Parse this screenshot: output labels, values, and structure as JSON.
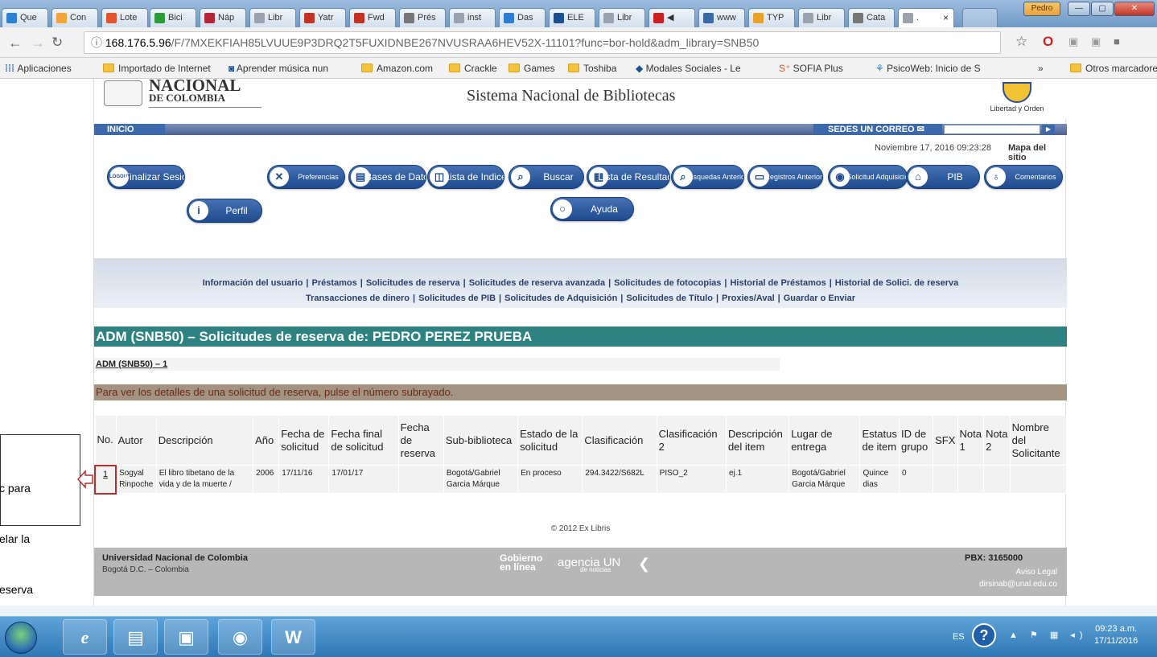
{
  "browser": {
    "tabs": [
      {
        "label": "Que",
        "color": "#2d7fd3"
      },
      {
        "label": "Con",
        "color": "#f2a43a"
      },
      {
        "label": "Lote",
        "color": "#e0552b"
      },
      {
        "label": "Bici",
        "color": "#2c9c3a"
      },
      {
        "label": "Náp",
        "color": "#b3263a"
      },
      {
        "label": "Libr",
        "color": "#9aa3ad"
      },
      {
        "label": "Yatr",
        "color": "#c23321"
      },
      {
        "label": "Fwd",
        "color": "#c23321"
      },
      {
        "label": "Prés",
        "color": "#777777"
      },
      {
        "label": "inst",
        "color": "#9aa3ad"
      },
      {
        "label": "Das",
        "color": "#2d7fd3"
      },
      {
        "label": "ELE",
        "color": "#1c4f8f"
      },
      {
        "label": "Libr",
        "color": "#9aa3ad"
      },
      {
        "label": "◀",
        "color": "#cc1f1f"
      },
      {
        "label": "www",
        "color": "#3a6aa5"
      },
      {
        "label": "TYP",
        "color": "#e8a22a"
      },
      {
        "label": "Libr",
        "color": "#9aa3ad"
      },
      {
        "label": "Cata",
        "color": "#777777"
      },
      {
        "label": ".",
        "color": "#9aa3ad"
      }
    ],
    "user_badge": "Pedro",
    "url_host": "168.176.5.96",
    "url_path": "/F/7MXEKFIAH85LVUUE9P3DRQ2T5FUXIDNBE267NVUSRAA6HEV52X-11101?func=bor-hold&adm_library=SNB50",
    "bookmarks": [
      "Aplicaciones",
      "Importado de Internet",
      "Aprender música nun",
      "Amazon.com",
      "Crackle",
      "Games",
      "Toshiba",
      "Modales Sociales - Le",
      "SOFIA Plus",
      "PsicoWeb: Inicio de S"
    ],
    "bookmarks_more": "»",
    "bookmarks_other": "Otros marcadores"
  },
  "header": {
    "logo_line1": "NACIONAL",
    "logo_line2": "DE COLOMBIA",
    "title": "Sistema Nacional de Bibliotecas",
    "coat_label": "Libertad y Orden",
    "inicio": "INICIO",
    "sedes": "SEDES UN  CORREO ✉",
    "date": "Noviembre 17, 2016 09:23:28",
    "mapa": "Mapa del sitio"
  },
  "nav_buttons": [
    {
      "label": "Finalizar Sesión",
      "icon": "LOGOUT"
    },
    {
      "label": "Perfil",
      "icon": "i"
    },
    {
      "label": "Preferencias",
      "icon": "✕"
    },
    {
      "label": "Bases de Datos",
      "icon": "▤"
    },
    {
      "label": "Lista de Indices",
      "icon": "◫"
    },
    {
      "label": "Buscar",
      "icon": "⌕"
    },
    {
      "label": "Lista de Resultados",
      "icon": "▦"
    },
    {
      "label": "Busquedas Anteriores",
      "icon": "⌕"
    },
    {
      "label": "Registros Anteriores",
      "icon": "▭"
    },
    {
      "label": "Solicitud Adquisición",
      "icon": "◉"
    },
    {
      "label": "PIB",
      "icon": "⌂"
    },
    {
      "label": "Comentarios",
      "icon": "♁"
    },
    {
      "label": "Ayuda",
      "icon": "○"
    }
  ],
  "links_row1": [
    "Información del usuario",
    "Préstamos",
    "Solicitudes de reserva",
    "Solicitudes de reserva avanzada",
    "Solicitudes de fotocopias",
    "Historial de Préstamos",
    "Historial de Solici. de reserva"
  ],
  "links_row2": [
    "Transacciones de dinero",
    "Solicitudes de PIB",
    "Solicitudes de Adquisición",
    "Solicitudes de Título",
    "Proxies/Aval",
    "Guardar o Enviar"
  ],
  "section_title": "ADM (SNB50) – Solicitudes de reserva de: PEDRO PEREZ PRUEBA",
  "adm_link": "ADM (SNB50) – 1",
  "info_text": "Para ver los detalles de una solicitud de reserva, pulse el número subrayado.",
  "table": {
    "headers": [
      "No.",
      "Autor",
      "Descripción",
      "Año",
      "Fecha de solicitud",
      "Fecha final de solicitud",
      "Fecha de reserva",
      "Sub-biblioteca",
      "Estado de la solicitud",
      "Clasificación",
      "Clasificación 2",
      "Descripción del item",
      "Lugar de entrega",
      "Estatus de item",
      "ID de grupo",
      "SFX",
      "Nota 1",
      "Nota 2",
      "Nombre del Solicitante"
    ],
    "rows": [
      [
        "1",
        "Sogyal Rinpoche",
        "El libro tibetano de la vida y de la muerte /",
        "2006",
        "17/11/16",
        "17/01/17",
        "",
        "Bogotá/Gabriel Garcia Márque",
        "En proceso",
        "294.3422/S682L",
        "PISO_2",
        "ej.1",
        "Bogotá/Gabriel Garcia Márque",
        "Quince dias",
        "0",
        "",
        "",
        "",
        ""
      ]
    ]
  },
  "copyright": "© 2012 Ex Libris",
  "footer": {
    "university": "Universidad Nacional de Colombia",
    "city": "Bogotá D.C. – Colombia",
    "gobierno": "Gobierno en línea",
    "agencia": "agencia UN",
    "agencia_sub": "de noticias",
    "pbx": "PBX: 3165000",
    "aviso": "Aviso Legal",
    "email": "dirsinab@unal.edu.co"
  },
  "callout_lines": [
    "c para",
    "elar la",
    "eserva"
  ],
  "taskbar": {
    "lang": "ES",
    "time": "09:23 a.m.",
    "date": "17/11/2016",
    "apps": [
      "internet-explorer",
      "file-explorer",
      "media-player",
      "chrome",
      "word"
    ]
  }
}
